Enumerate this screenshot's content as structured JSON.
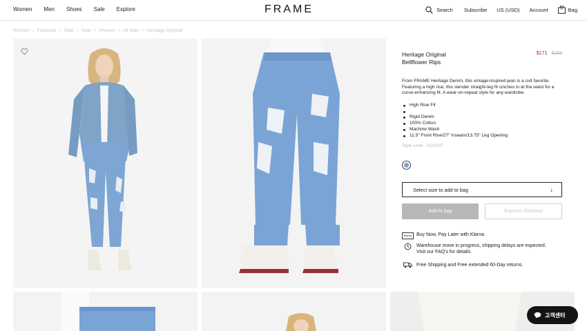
{
  "header": {
    "nav_left": [
      "Women",
      "Men",
      "Shoes",
      "Sale",
      "Explore"
    ],
    "logo": "FRAME",
    "search_label": "Search",
    "subscribe_label": "Subscribe",
    "currency_label": "US (USD)",
    "account_label": "Account",
    "bag_label": "Bag",
    "bag_count": "0"
  },
  "breadcrumb": [
    "Women",
    "/",
    "Featured",
    "/",
    "Sale",
    "/",
    "Sale",
    "/",
    "Women",
    "/",
    "All Sale",
    "/",
    "Heritage Original"
  ],
  "product": {
    "title_line1": "Heritage Original",
    "title_line2": "Bellflower Rips",
    "sale_price": "$171",
    "original_price": "$285",
    "description": "From FRAME Heritage Denim, this vintage-inspired jean is a cult favorite. Featuring a high rise, this slender straight-leg fit cinches in at the waist for a curve-enhancing fit. A wear-on-repeat style for any wardrobe.",
    "features": [
      "High Rise Fit",
      "",
      "Rigid Denim",
      "100% Cotton",
      "Machine Wash",
      "11.5\" Front Rise/27\" Inseam/13.75\" Leg Opening"
    ],
    "style_code": "Style code : HOJ207",
    "swatch_color": "#7ea2d0",
    "size_select_label": "Select size to add to bag",
    "add_to_bag_label": "Add to bag",
    "express_checkout_label": "Express checkout",
    "klarna_badge": "Klarna",
    "klarna_text": "Buy Now, Pay Later with Klarna",
    "warehouse_line1": "Warehouse move in progress, shipping delays are expected.",
    "warehouse_line2": "Visit our FAQ's for details.",
    "shipping_text": "Free Shipping and Free extended 60-Day returns."
  },
  "chat": {
    "label": "고객센터"
  },
  "colors": {
    "sale_red": "#b0182a",
    "denim": "#7ea2d0",
    "disabled_gray": "#b7b7b7"
  }
}
